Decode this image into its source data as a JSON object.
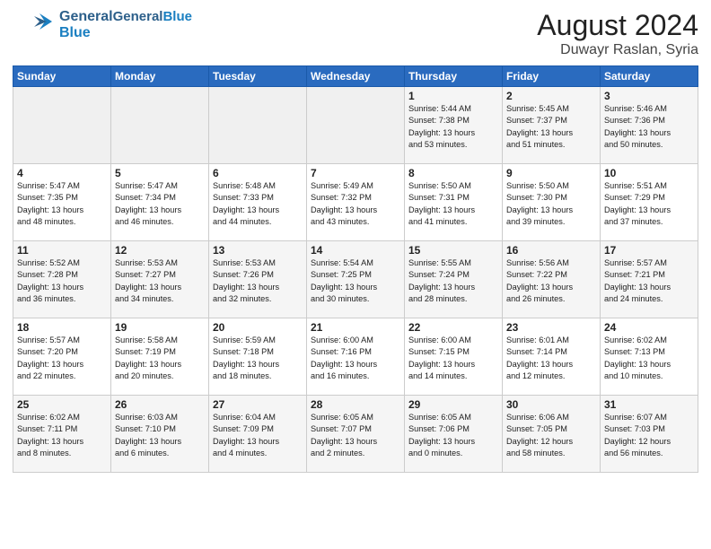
{
  "header": {
    "logo_general": "General",
    "logo_blue": "Blue",
    "month": "August 2024",
    "location": "Duwayr Raslan, Syria"
  },
  "weekdays": [
    "Sunday",
    "Monday",
    "Tuesday",
    "Wednesday",
    "Thursday",
    "Friday",
    "Saturday"
  ],
  "weeks": [
    [
      {
        "day": "",
        "info": ""
      },
      {
        "day": "",
        "info": ""
      },
      {
        "day": "",
        "info": ""
      },
      {
        "day": "",
        "info": ""
      },
      {
        "day": "1",
        "info": "Sunrise: 5:44 AM\nSunset: 7:38 PM\nDaylight: 13 hours\nand 53 minutes."
      },
      {
        "day": "2",
        "info": "Sunrise: 5:45 AM\nSunset: 7:37 PM\nDaylight: 13 hours\nand 51 minutes."
      },
      {
        "day": "3",
        "info": "Sunrise: 5:46 AM\nSunset: 7:36 PM\nDaylight: 13 hours\nand 50 minutes."
      }
    ],
    [
      {
        "day": "4",
        "info": "Sunrise: 5:47 AM\nSunset: 7:35 PM\nDaylight: 13 hours\nand 48 minutes."
      },
      {
        "day": "5",
        "info": "Sunrise: 5:47 AM\nSunset: 7:34 PM\nDaylight: 13 hours\nand 46 minutes."
      },
      {
        "day": "6",
        "info": "Sunrise: 5:48 AM\nSunset: 7:33 PM\nDaylight: 13 hours\nand 44 minutes."
      },
      {
        "day": "7",
        "info": "Sunrise: 5:49 AM\nSunset: 7:32 PM\nDaylight: 13 hours\nand 43 minutes."
      },
      {
        "day": "8",
        "info": "Sunrise: 5:50 AM\nSunset: 7:31 PM\nDaylight: 13 hours\nand 41 minutes."
      },
      {
        "day": "9",
        "info": "Sunrise: 5:50 AM\nSunset: 7:30 PM\nDaylight: 13 hours\nand 39 minutes."
      },
      {
        "day": "10",
        "info": "Sunrise: 5:51 AM\nSunset: 7:29 PM\nDaylight: 13 hours\nand 37 minutes."
      }
    ],
    [
      {
        "day": "11",
        "info": "Sunrise: 5:52 AM\nSunset: 7:28 PM\nDaylight: 13 hours\nand 36 minutes."
      },
      {
        "day": "12",
        "info": "Sunrise: 5:53 AM\nSunset: 7:27 PM\nDaylight: 13 hours\nand 34 minutes."
      },
      {
        "day": "13",
        "info": "Sunrise: 5:53 AM\nSunset: 7:26 PM\nDaylight: 13 hours\nand 32 minutes."
      },
      {
        "day": "14",
        "info": "Sunrise: 5:54 AM\nSunset: 7:25 PM\nDaylight: 13 hours\nand 30 minutes."
      },
      {
        "day": "15",
        "info": "Sunrise: 5:55 AM\nSunset: 7:24 PM\nDaylight: 13 hours\nand 28 minutes."
      },
      {
        "day": "16",
        "info": "Sunrise: 5:56 AM\nSunset: 7:22 PM\nDaylight: 13 hours\nand 26 minutes."
      },
      {
        "day": "17",
        "info": "Sunrise: 5:57 AM\nSunset: 7:21 PM\nDaylight: 13 hours\nand 24 minutes."
      }
    ],
    [
      {
        "day": "18",
        "info": "Sunrise: 5:57 AM\nSunset: 7:20 PM\nDaylight: 13 hours\nand 22 minutes."
      },
      {
        "day": "19",
        "info": "Sunrise: 5:58 AM\nSunset: 7:19 PM\nDaylight: 13 hours\nand 20 minutes."
      },
      {
        "day": "20",
        "info": "Sunrise: 5:59 AM\nSunset: 7:18 PM\nDaylight: 13 hours\nand 18 minutes."
      },
      {
        "day": "21",
        "info": "Sunrise: 6:00 AM\nSunset: 7:16 PM\nDaylight: 13 hours\nand 16 minutes."
      },
      {
        "day": "22",
        "info": "Sunrise: 6:00 AM\nSunset: 7:15 PM\nDaylight: 13 hours\nand 14 minutes."
      },
      {
        "day": "23",
        "info": "Sunrise: 6:01 AM\nSunset: 7:14 PM\nDaylight: 13 hours\nand 12 minutes."
      },
      {
        "day": "24",
        "info": "Sunrise: 6:02 AM\nSunset: 7:13 PM\nDaylight: 13 hours\nand 10 minutes."
      }
    ],
    [
      {
        "day": "25",
        "info": "Sunrise: 6:02 AM\nSunset: 7:11 PM\nDaylight: 13 hours\nand 8 minutes."
      },
      {
        "day": "26",
        "info": "Sunrise: 6:03 AM\nSunset: 7:10 PM\nDaylight: 13 hours\nand 6 minutes."
      },
      {
        "day": "27",
        "info": "Sunrise: 6:04 AM\nSunset: 7:09 PM\nDaylight: 13 hours\nand 4 minutes."
      },
      {
        "day": "28",
        "info": "Sunrise: 6:05 AM\nSunset: 7:07 PM\nDaylight: 13 hours\nand 2 minutes."
      },
      {
        "day": "29",
        "info": "Sunrise: 6:05 AM\nSunset: 7:06 PM\nDaylight: 13 hours\nand 0 minutes."
      },
      {
        "day": "30",
        "info": "Sunrise: 6:06 AM\nSunset: 7:05 PM\nDaylight: 12 hours\nand 58 minutes."
      },
      {
        "day": "31",
        "info": "Sunrise: 6:07 AM\nSunset: 7:03 PM\nDaylight: 12 hours\nand 56 minutes."
      }
    ]
  ]
}
